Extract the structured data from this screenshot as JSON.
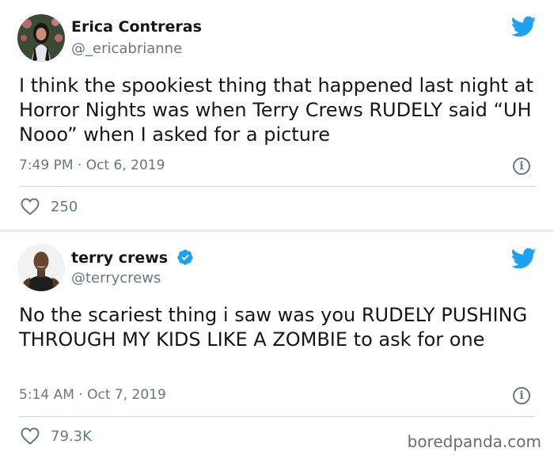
{
  "tweets": [
    {
      "author_name": "Erica Contreras",
      "author_handle": "@_ericabrianne",
      "verified": false,
      "text": "I think the spookiest thing that happened last night at Horror Nights was when Terry Crews RUDELY said “UH Nooo” when I asked for a picture",
      "timestamp": "7:49 PM · Oct 6, 2019",
      "likes": "250",
      "like_icon": "heart-outline-icon"
    },
    {
      "author_name": "terry crews",
      "author_handle": "@terrycrews",
      "verified": true,
      "text": "No the scariest thing i saw was you RUDELY PUSHING THROUGH MY KIDS LIKE A ZOMBIE to ask for one",
      "timestamp": "5:14 AM · Oct 7, 2019",
      "likes": "79.3K",
      "like_icon": "heart-outline-icon"
    }
  ],
  "watermark": "boredpanda.com",
  "colors": {
    "twitter_blue": "#1da1f2",
    "secondary_text": "#657786",
    "primary_text": "#14171a",
    "divider": "#ccd6dd"
  }
}
